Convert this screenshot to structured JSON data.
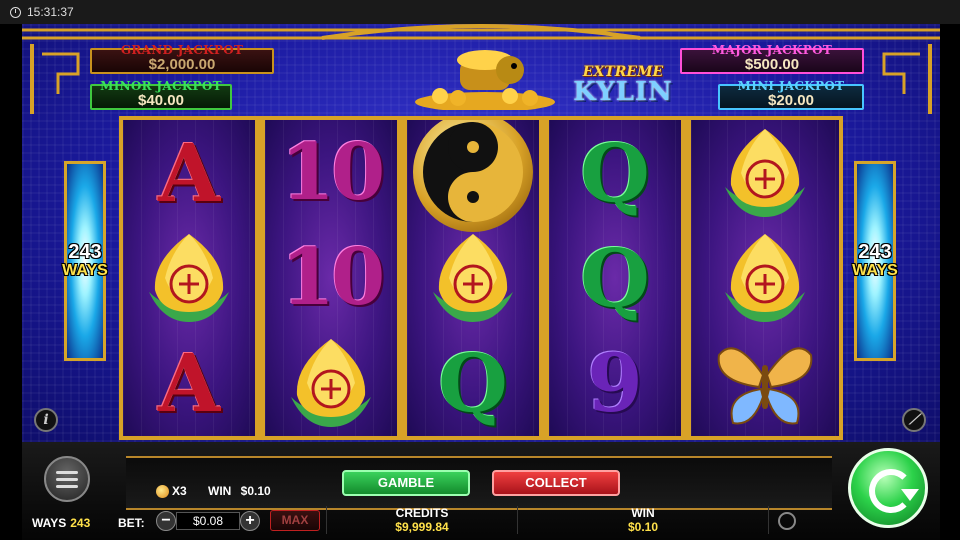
{
  "status_bar": {
    "time": "15:31:37"
  },
  "jackpots": {
    "grand": {
      "title": "GRAND JACKPOT",
      "value": "$2,000.00"
    },
    "minor": {
      "title": "MINOR JACKPOT",
      "value": "$40.00"
    },
    "major": {
      "title": "MAJOR JACKPOT",
      "value": "$500.00"
    },
    "mini": {
      "title": "MINI JACKPOT",
      "value": "$20.00"
    }
  },
  "logo": {
    "line1": "EXTREME",
    "line2": "KYLIN"
  },
  "side_panels": {
    "ways_number": "243",
    "ways_label": "WAYS"
  },
  "reels": [
    [
      "A",
      "peach",
      "A"
    ],
    [
      "10",
      "10",
      "peach"
    ],
    [
      "yin-yang",
      "peach",
      "Q"
    ],
    [
      "Q",
      "Q",
      "9"
    ],
    [
      "peach",
      "peach",
      "butterfly"
    ]
  ],
  "feature": {
    "peach_multiplier": "X3",
    "win_label": "WIN",
    "win_value": "$0.10"
  },
  "buttons": {
    "gamble": "GAMBLE",
    "collect": "COLLECT"
  },
  "bottom_bar": {
    "ways_label": "WAYS",
    "ways_value": "243",
    "bet_label": "BET:",
    "bet_value": "$0.08",
    "minus": "−",
    "plus": "+",
    "max_label": "MAX",
    "credits_label": "CREDITS",
    "credits_value": "$9,999.84",
    "win_label": "WIN",
    "win_value": "$0.10"
  },
  "colors": {
    "frame_gold": "#d8a227",
    "background_blue": "#1b1aa0",
    "gamble_green": "#138a2c",
    "collect_red": "#a8121a",
    "spin_green": "#2cd24a"
  }
}
